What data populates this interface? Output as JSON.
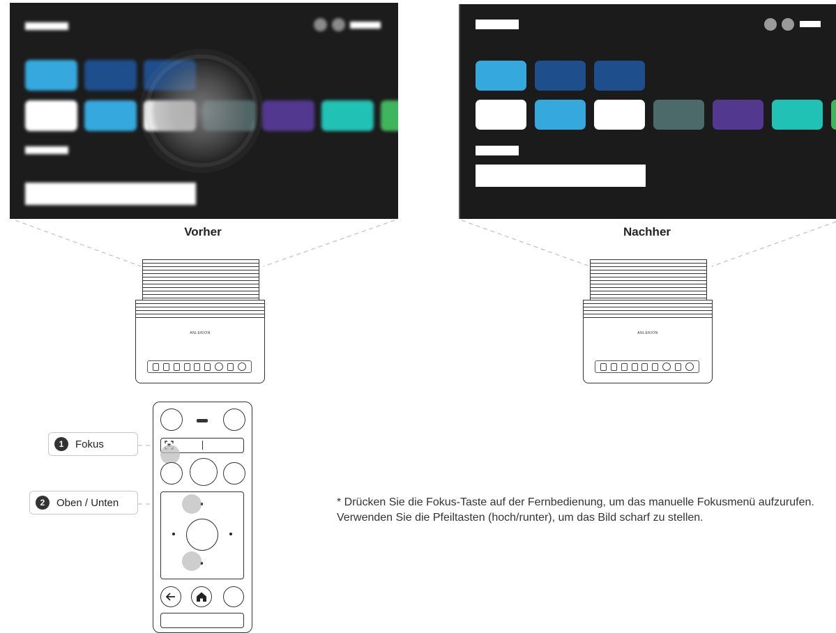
{
  "captions": {
    "before": "Vorher",
    "after": "Nachher"
  },
  "projector": {
    "brand": "ANLERION"
  },
  "remote": {
    "callouts": [
      {
        "number": "1",
        "label": "Fokus"
      },
      {
        "number": "2",
        "label": "Oben / Unten"
      }
    ]
  },
  "note": "* Drücken Sie die Fokus-Taste auf der Fernbedienung, um das manuelle Fokusmenü aufzurufen. Verwenden Sie die Pfeiltasten (hoch/runter), um das Bild scharf zu stellen.",
  "colors": {
    "screen_bg": "#1c1c1c",
    "tile_light_blue": "#35a9de",
    "tile_dark_blue": "#1f4e8c",
    "tile_white": "#ffffff",
    "tile_slate": "#4d6a6a",
    "tile_purple": "#52388f",
    "tile_teal": "#22c1b5",
    "tile_green": "#3fb55d"
  }
}
